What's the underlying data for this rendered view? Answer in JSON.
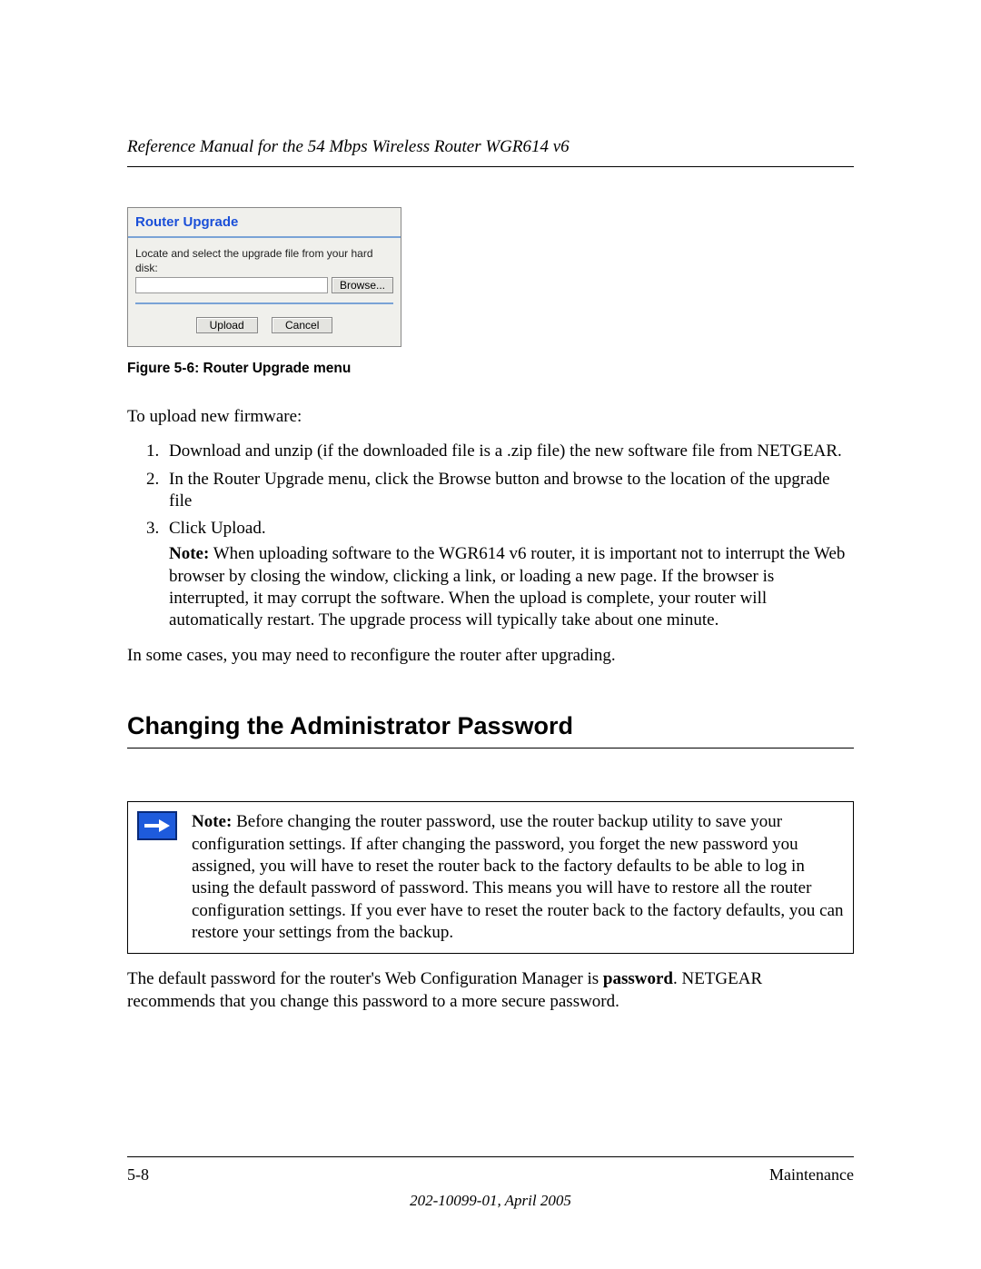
{
  "header": {
    "running_title": "Reference Manual for the 54 Mbps Wireless Router WGR614 v6"
  },
  "figure": {
    "panel_title": "Router Upgrade",
    "instruction": "Locate and select the upgrade file from your hard disk:",
    "browse_label": "Browse...",
    "upload_label": "Upload",
    "cancel_label": "Cancel",
    "caption": "Figure 5-6:  Router Upgrade menu"
  },
  "body": {
    "intro": "To upload new firmware:",
    "steps": [
      "Download and unzip (if the downloaded file is a .zip file) the new software file from NETGEAR.",
      "In the Router Upgrade menu, click the Browse button and browse to the location of the upgrade file",
      "Click Upload."
    ],
    "step3_note_label": "Note:",
    "step3_note_body": " When uploading software to the WGR614 v6 router, it is important not to interrupt the Web browser by closing the window, clicking a link, or loading a new page. If the browser is interrupted, it may corrupt the software. When the upload is complete, your router will automatically restart. The upgrade process will typically take about one minute.",
    "after_list": "In some cases, you may need to reconfigure the router after upgrading."
  },
  "section2": {
    "heading": "Changing the Administrator Password",
    "note_label": "Note:",
    "note_body": " Before changing the router password, use the router backup utility to save your configuration settings. If after changing the password, you forget the new password you assigned, you will have to reset the router back to the factory defaults to be able to log in using the default password of password. This means you will have to restore all the router configuration settings. If you ever have to reset the router back to the factory defaults, you can restore your settings from the backup.",
    "after_note_pre": "The default password for the router's Web Configuration Manager is ",
    "after_note_bold": "password",
    "after_note_post": ". NETGEAR recommends that you change this password to a more secure password."
  },
  "footer": {
    "page_num": "5-8",
    "section_name": "Maintenance",
    "doc_id": "202-10099-01, April 2005"
  }
}
